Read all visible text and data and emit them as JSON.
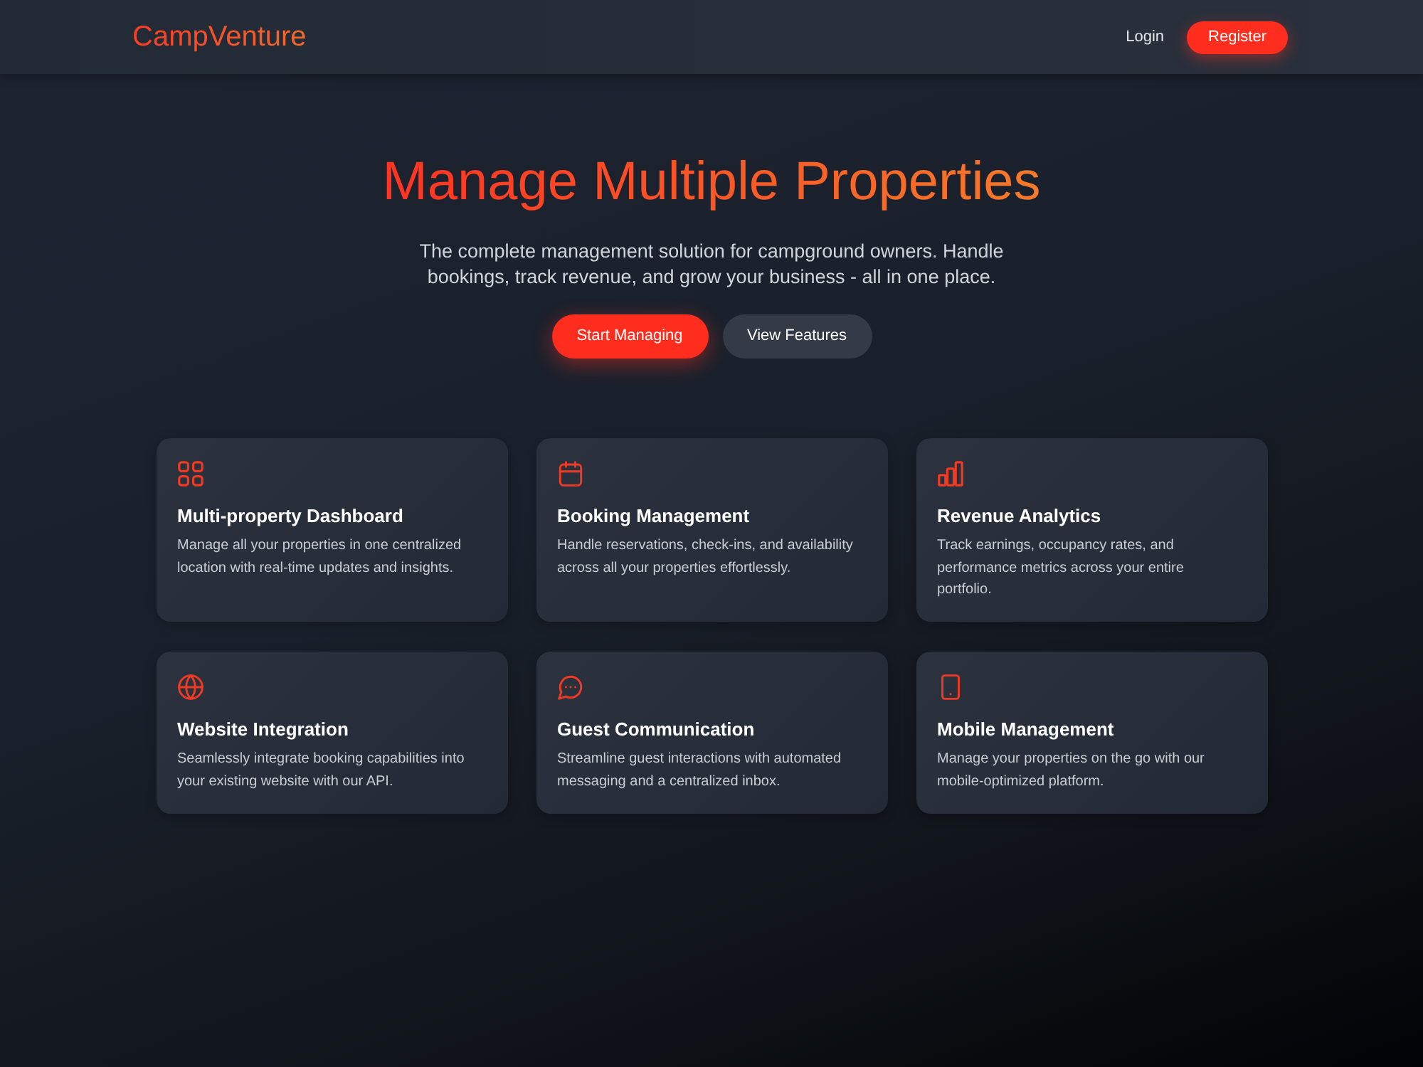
{
  "header": {
    "logo": "CampVenture",
    "nav": [
      {
        "label": "Login",
        "kind": "link"
      },
      {
        "label": "Register",
        "kind": "button"
      }
    ]
  },
  "hero": {
    "title": "Manage Multiple Properties",
    "subtitle": "The complete management solution for campground owners. Handle bookings, track revenue, and grow your business - all in one place.",
    "buttons": [
      {
        "label": "Start Managing",
        "kind": "primary"
      },
      {
        "label": "View Features",
        "kind": "secondary"
      }
    ]
  },
  "features": [
    {
      "title": "Multi-property Dashboard",
      "description": "Manage all your properties in one centralized location with real-time updates and insights."
    },
    {
      "title": "Booking Management",
      "description": "Handle reservations, check-ins, and availability across all your properties effortlessly."
    },
    {
      "title": "Revenue Analytics",
      "description": "Track earnings, occupancy rates, and performance metrics across your entire portfolio."
    },
    {
      "title": "Website Integration",
      "description": "Seamlessly integrate booking capabilities into your existing website with our API."
    },
    {
      "title": "Guest Communication",
      "description": "Streamline guest interactions with automated messaging and a centralized inbox."
    },
    {
      "title": "Mobile Management",
      "description": "Manage your properties on the go with our mobile-optimized platform."
    }
  ]
}
